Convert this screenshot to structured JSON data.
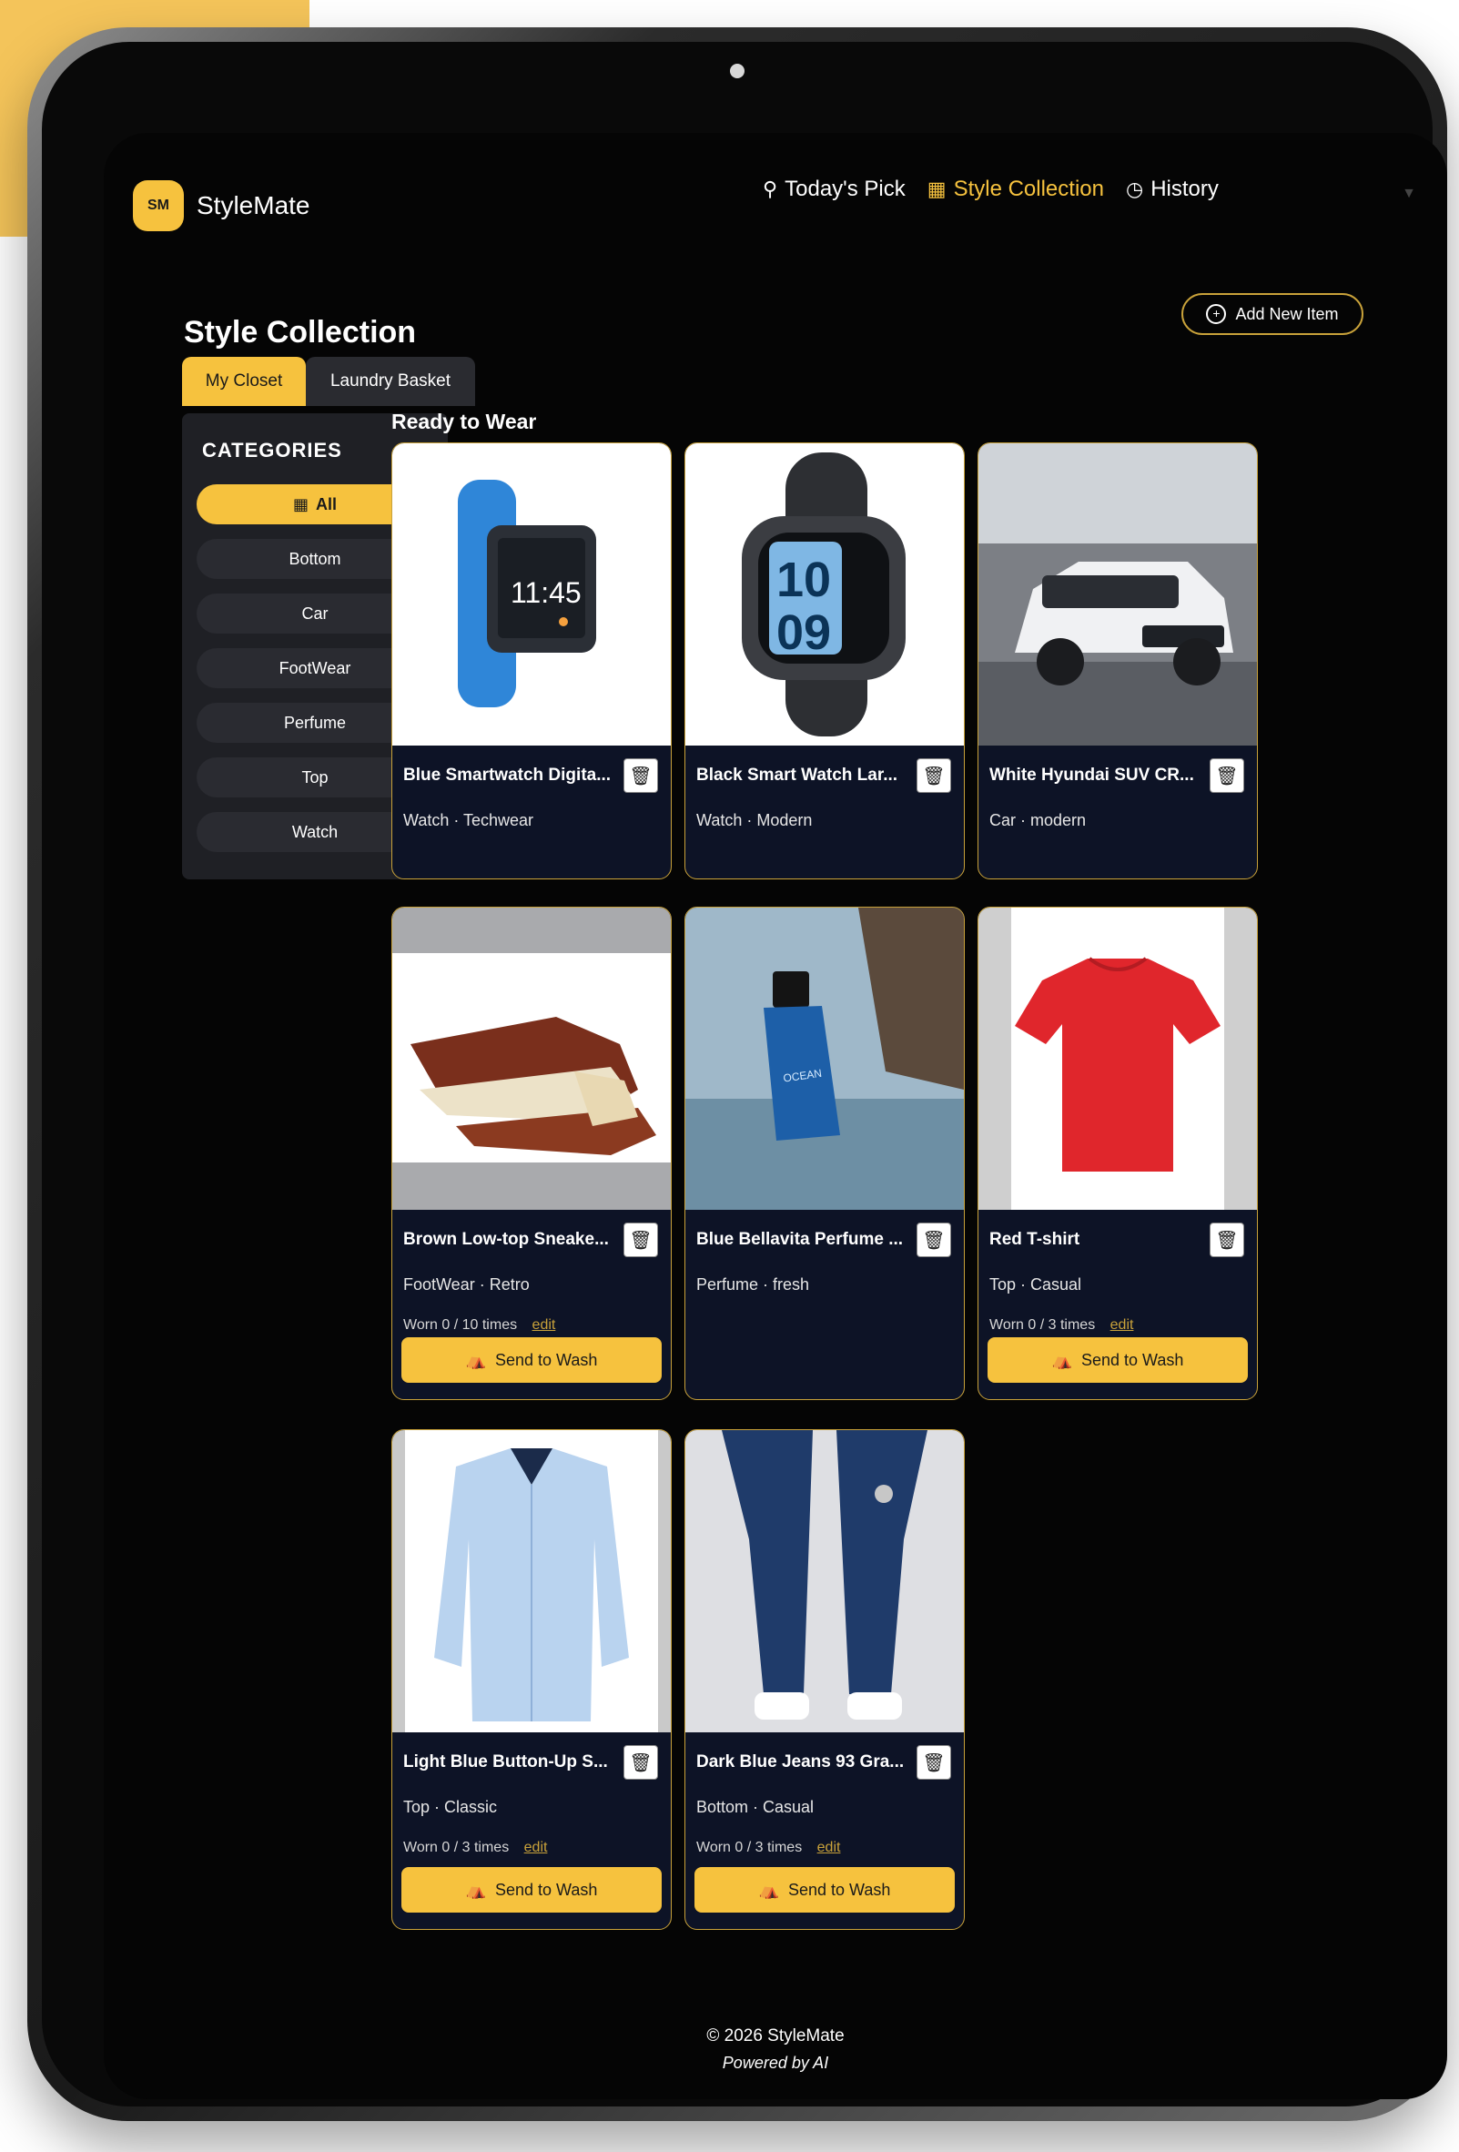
{
  "app": {
    "logo_badge": "SM",
    "logo_text": "StyleMate",
    "accent_color": "#f6c23e"
  },
  "nav": {
    "items": [
      {
        "label": "Today's Pick",
        "icon": "wand-icon"
      },
      {
        "label": "Style Collection",
        "icon": "grid-icon"
      },
      {
        "label": "History",
        "icon": "clock-icon"
      }
    ],
    "active": "Style Collection"
  },
  "page": {
    "title": "Style Collection",
    "add_button": "Add New Item"
  },
  "tabs": [
    "My Closet",
    "Laundry Basket"
  ],
  "sidebar": {
    "title": "CATEGORIES",
    "items": [
      "All",
      "Bottom",
      "Car",
      "FootWear",
      "Perfume",
      "Top",
      "Watch"
    ]
  },
  "main": {
    "section_label": "Ready to Wear",
    "items": [
      {
        "name": "Blue Smartwatch Digita...",
        "meta": "Watch · Techwear"
      },
      {
        "name": "Black Smart Watch Lar...",
        "meta": "Watch · Modern"
      },
      {
        "name": "White Hyundai SUV CR...",
        "meta": "Car · modern"
      },
      {
        "name": "Brown Low-top Sneake...",
        "meta": "FootWear · Retro",
        "worn": "Worn 0 / 10 times",
        "edit": "edit",
        "action": "Send to Wash"
      },
      {
        "name": "Blue Bellavita Perfume ...",
        "meta": "Perfume · fresh"
      },
      {
        "name": "Red T-shirt",
        "meta": "Top · Casual",
        "worn": "Worn 0 / 3 times",
        "edit": "edit",
        "action": "Send to Wash"
      },
      {
        "name": "Light Blue Button-Up S...",
        "meta": "Top · Classic",
        "worn": "Worn 0 / 3 times",
        "edit": "edit",
        "action": "Send to Wash"
      },
      {
        "name": "Dark Blue Jeans 93 Gra...",
        "meta": "Bottom · Casual",
        "worn": "Worn 0 / 3 times",
        "edit": "edit",
        "action": "Send to Wash"
      }
    ]
  },
  "footer": {
    "copyright": "© 2026 StyleMate",
    "powered": "Powered by AI"
  }
}
